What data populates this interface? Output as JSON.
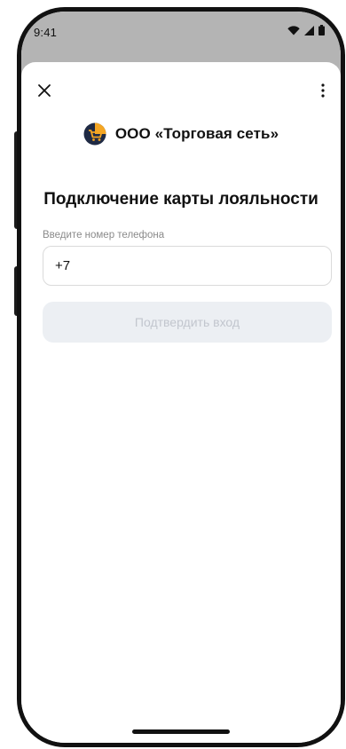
{
  "status_bar": {
    "time": "9:41",
    "icons": [
      "wifi-icon",
      "signal-icon",
      "battery-icon"
    ]
  },
  "toolbar": {
    "close_icon": "close-icon",
    "more_icon": "more-vertical-icon"
  },
  "brand": {
    "name": "ООО «Торговая сеть»",
    "logo_icon": "shopping-cart-icon",
    "logo_color": "#f5a623"
  },
  "title": "Подключение карты лояльности",
  "phone_field": {
    "label": "Введите номер телефона",
    "value": "+7"
  },
  "confirm_button": {
    "label": "Подтвердить вход",
    "state": "disabled"
  }
}
